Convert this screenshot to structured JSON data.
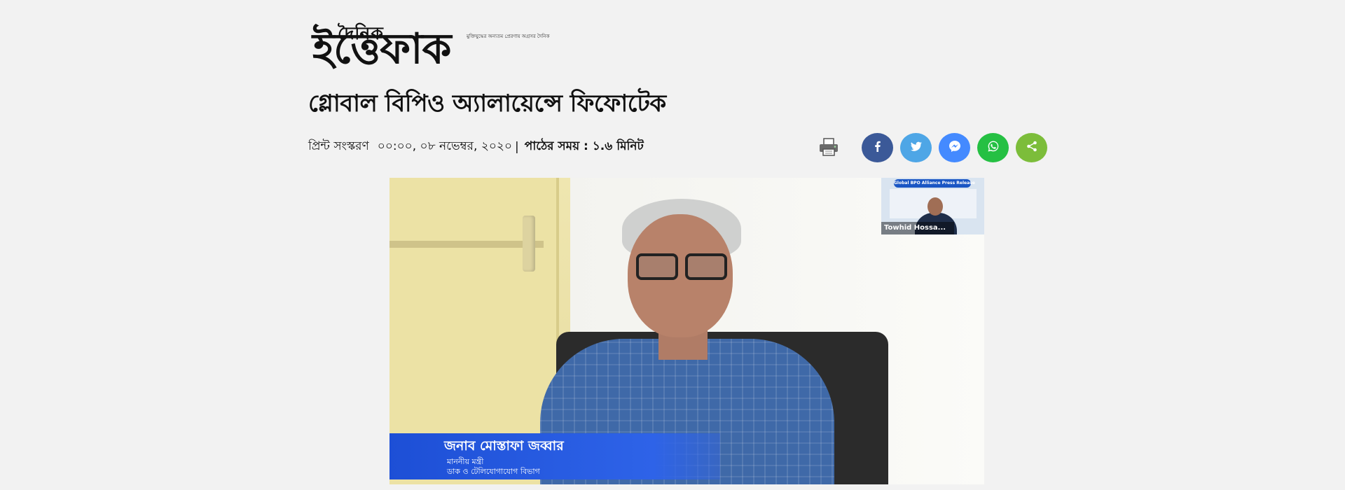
{
  "masthead": {
    "logo_small": "দৈনিক",
    "logo_big": "ইত্তেফাক",
    "tagline": "মুক্তিযুদ্ধের অন্যতম প্রেরণায় অগ্রসর দৈনিক",
    "logo_color": "#111111"
  },
  "article": {
    "headline": "গ্লোবাল বিপিও অ্যালায়েন্সে ফিফোটেক",
    "edition": "প্রিন্ট সংস্করণ",
    "datetime": "০০:০০, ০৮ নভেম্বর, ২০২০",
    "separator": "|",
    "read_time": "পাঠের সময় : ১.৬ মিনিট"
  },
  "toolbar": {
    "print_icon": "printer-icon",
    "share": [
      {
        "name": "facebook",
        "icon": "facebook-icon",
        "color": "#3b5998"
      },
      {
        "name": "twitter",
        "icon": "twitter-icon",
        "color": "#4ea6e6"
      },
      {
        "name": "messenger",
        "icon": "messenger-icon",
        "color": "#448aff"
      },
      {
        "name": "whatsapp",
        "icon": "whatsapp-icon",
        "color": "#25c043"
      },
      {
        "name": "share",
        "icon": "share-icon",
        "color": "#7cbd3a"
      }
    ]
  },
  "video": {
    "lower_third": {
      "name": "জনাব মোস্তাফা জব্বার",
      "role": "মাননীয় মন্ত্রী",
      "department": "ডাক ও টেলিযোগাযোগ বিভাগ",
      "color": "#1d4fd6"
    },
    "pip": {
      "banner": "Global BPO Alliance Press Release",
      "label": "Towhid Hossa..."
    }
  }
}
